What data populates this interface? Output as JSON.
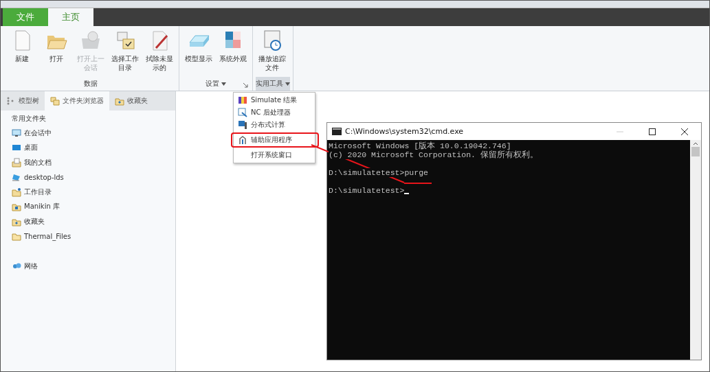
{
  "app_tabs": [
    {
      "label": "文件",
      "kind": "file",
      "selected": false
    },
    {
      "label": "主页",
      "kind": "page",
      "selected": true
    }
  ],
  "ribbon_groups": [
    {
      "label": "数据",
      "launcher": false,
      "menu": false,
      "buttons": [
        {
          "label": "新建",
          "kind": "new",
          "disabled": false
        },
        {
          "label": "打开",
          "kind": "open",
          "disabled": false
        },
        {
          "label": "打开上一会话",
          "kind": "session",
          "disabled": true
        },
        {
          "label": "选择工作目录",
          "kind": "workdir",
          "disabled": false
        },
        {
          "label": "拭除未显示的",
          "kind": "erase",
          "disabled": false
        }
      ]
    },
    {
      "label": "设置",
      "launcher": true,
      "menu": true,
      "buttons": [
        {
          "label": "模型显示",
          "kind": "display",
          "disabled": false
        },
        {
          "label": "系统外观",
          "kind": "appearance",
          "disabled": false
        }
      ]
    },
    {
      "label": "实用工具",
      "launcher": false,
      "menu": true,
      "expanded": true,
      "buttons": [
        {
          "label": "播放追踪文件",
          "kind": "trail",
          "disabled": false
        }
      ]
    }
  ],
  "navigator_tabs": [
    {
      "label": "模型树",
      "kind": "tree",
      "selected": false
    },
    {
      "label": "文件夹浏览器",
      "kind": "folders",
      "selected": true
    },
    {
      "label": "收藏夹",
      "kind": "favorites",
      "selected": false
    }
  ],
  "folders": {
    "heading": "常用文件夹",
    "items": [
      {
        "label": "在会话中",
        "kind": "monitor"
      },
      {
        "label": "桌面",
        "kind": "desktop"
      },
      {
        "label": "我的文档",
        "kind": "documents"
      },
      {
        "label": "desktop-lds",
        "kind": "computer"
      },
      {
        "label": "工作目录",
        "kind": "workdir"
      },
      {
        "label": "Manikin 库",
        "kind": "library"
      },
      {
        "label": "收藏夹",
        "kind": "favorites"
      },
      {
        "label": "Thermal_Files",
        "kind": "folder"
      }
    ],
    "network": {
      "label": "网络"
    }
  },
  "tools_menu": [
    {
      "label": "Simulate 结果",
      "kind": "simulate",
      "highlighted": false
    },
    {
      "label": "NC 后处理器",
      "kind": "nc",
      "highlighted": false
    },
    {
      "label": "分布式计算",
      "kind": "distributed",
      "highlighted": false
    },
    {
      "label": "辅助应用程序",
      "kind": "auxiliary",
      "highlighted": true
    },
    {
      "label": "打开系统窗口",
      "kind": "none",
      "highlighted": false
    }
  ],
  "console": {
    "title": "C:\\Windows\\system32\\cmd.exe",
    "blocks": [
      [
        "Microsoft Windows [版本 10.0.19042.746]",
        "(c) 2020 Microsoft Corporation. 保留所有权利。"
      ],
      [
        {
          "prompt": "D:\\simulatetest>",
          "command": "purge",
          "underlined": true
        }
      ],
      [
        {
          "prompt": "D:\\simulatetest>",
          "cursor": true
        }
      ]
    ]
  }
}
